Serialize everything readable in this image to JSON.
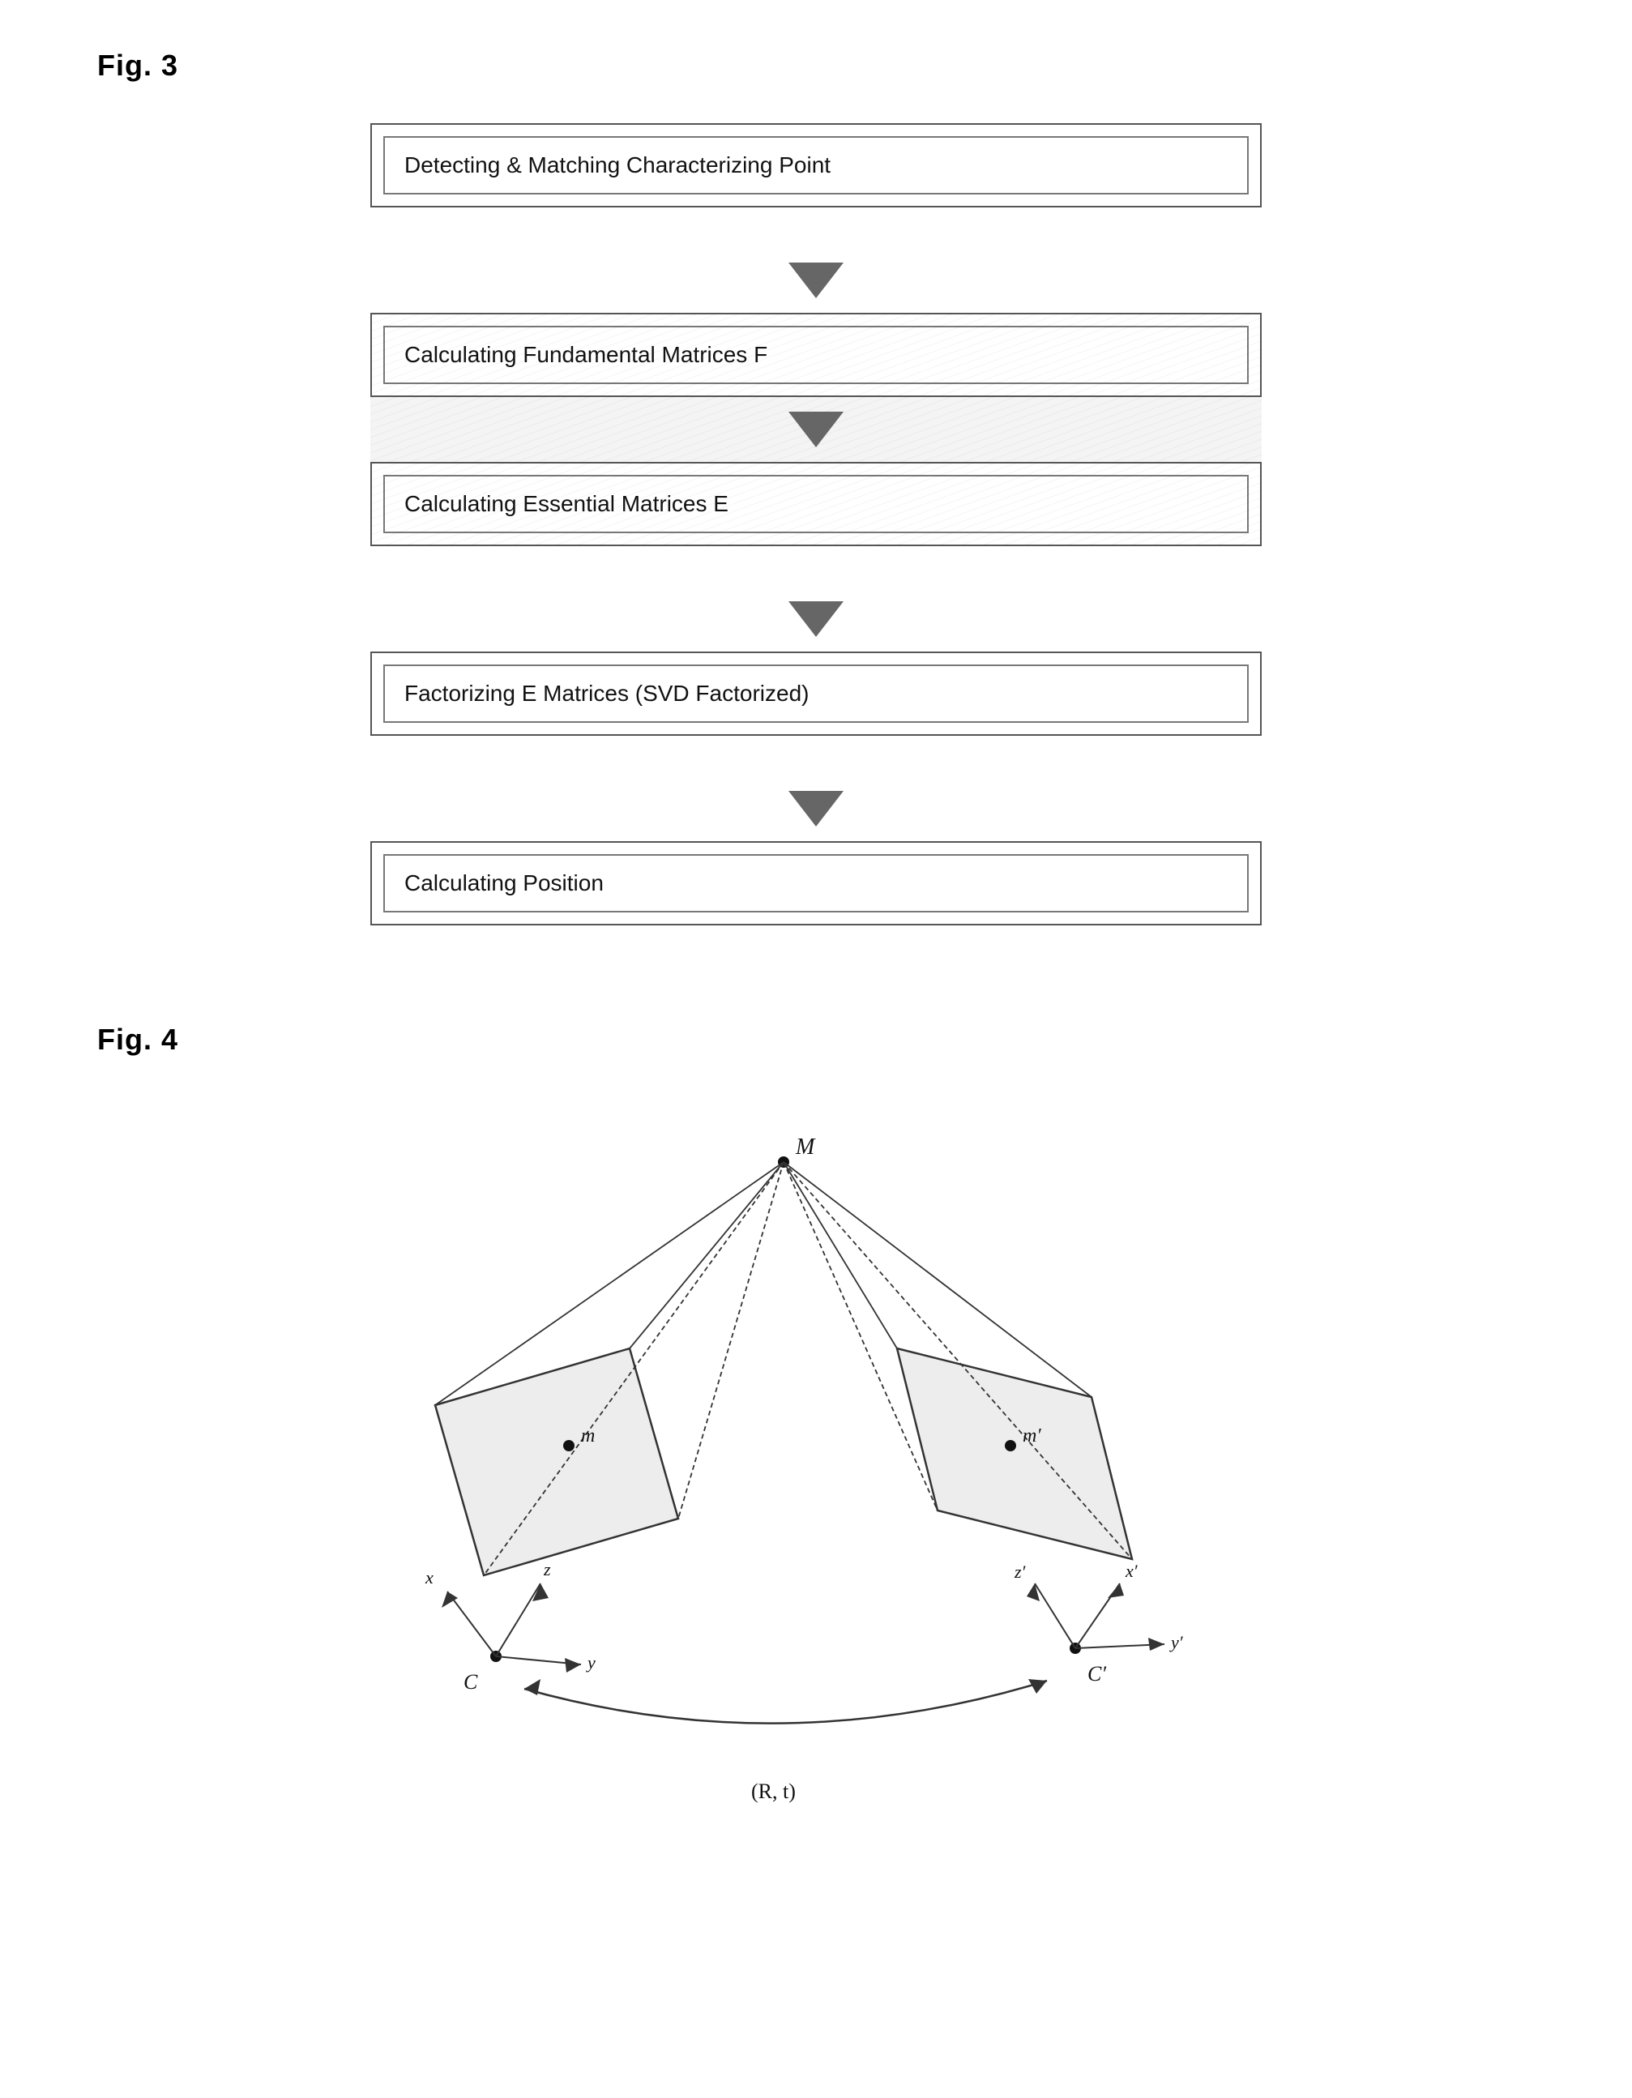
{
  "fig3": {
    "label": "Fig. 3",
    "boxes": [
      {
        "id": "box1",
        "text": "Detecting & Matching Characterizing Point"
      },
      {
        "id": "box2",
        "text": "Calculating Fundamental Matrices F"
      },
      {
        "id": "box3",
        "text": "Calculating Essential Matrices E"
      },
      {
        "id": "box4",
        "text": "Factorizing E Matrices (SVD Factorized)"
      },
      {
        "id": "box5",
        "text": "Calculating Position"
      }
    ]
  },
  "fig4": {
    "label": "Fig. 4",
    "labels": {
      "M": "M",
      "m": "m",
      "m_prime": "m′",
      "C": "C",
      "C_prime": "C′",
      "Rt": "(R, t)",
      "x": "x",
      "y": "y",
      "z": "z",
      "x_prime": "x′",
      "y_prime": "y′",
      "z_prime": "z′"
    }
  }
}
